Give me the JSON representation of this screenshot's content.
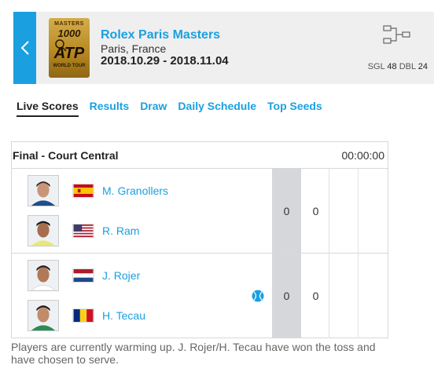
{
  "header": {
    "logo": {
      "masters": "MASTERS",
      "level": "1000",
      "brand": "ATP",
      "tour": "WORLD TOUR"
    },
    "tournament_name": "Rolex Paris Masters",
    "location": "Paris, France",
    "dates": "2018.10.29 - 2018.11.04",
    "draw_icon": "bracket-icon",
    "sgl_label": "SGL",
    "sgl_count": "48",
    "dbl_label": "DBL",
    "dbl_count": "24",
    "accent": "#1aa0e0"
  },
  "tabs": [
    {
      "label": "Live Scores",
      "active": true
    },
    {
      "label": "Results"
    },
    {
      "label": "Draw"
    },
    {
      "label": "Daily Schedule"
    },
    {
      "label": "Top Seeds"
    }
  ],
  "match": {
    "round": "Final - Court Central",
    "time": "00:00:00",
    "teams": [
      {
        "players": [
          {
            "name": "M. Granollers",
            "flag": "spain-flag"
          },
          {
            "name": "R. Ram",
            "flag": "usa-flag"
          }
        ],
        "scores": [
          "0",
          "0"
        ],
        "serving": false
      },
      {
        "players": [
          {
            "name": "J. Rojer",
            "flag": "netherlands-flag"
          },
          {
            "name": "H. Tecau",
            "flag": "romania-flag"
          }
        ],
        "scores": [
          "0",
          "0"
        ],
        "serving": true
      }
    ],
    "status": "Players are currently warming up. J. Rojer/H. Tecau have won the toss and have chosen to serve."
  }
}
